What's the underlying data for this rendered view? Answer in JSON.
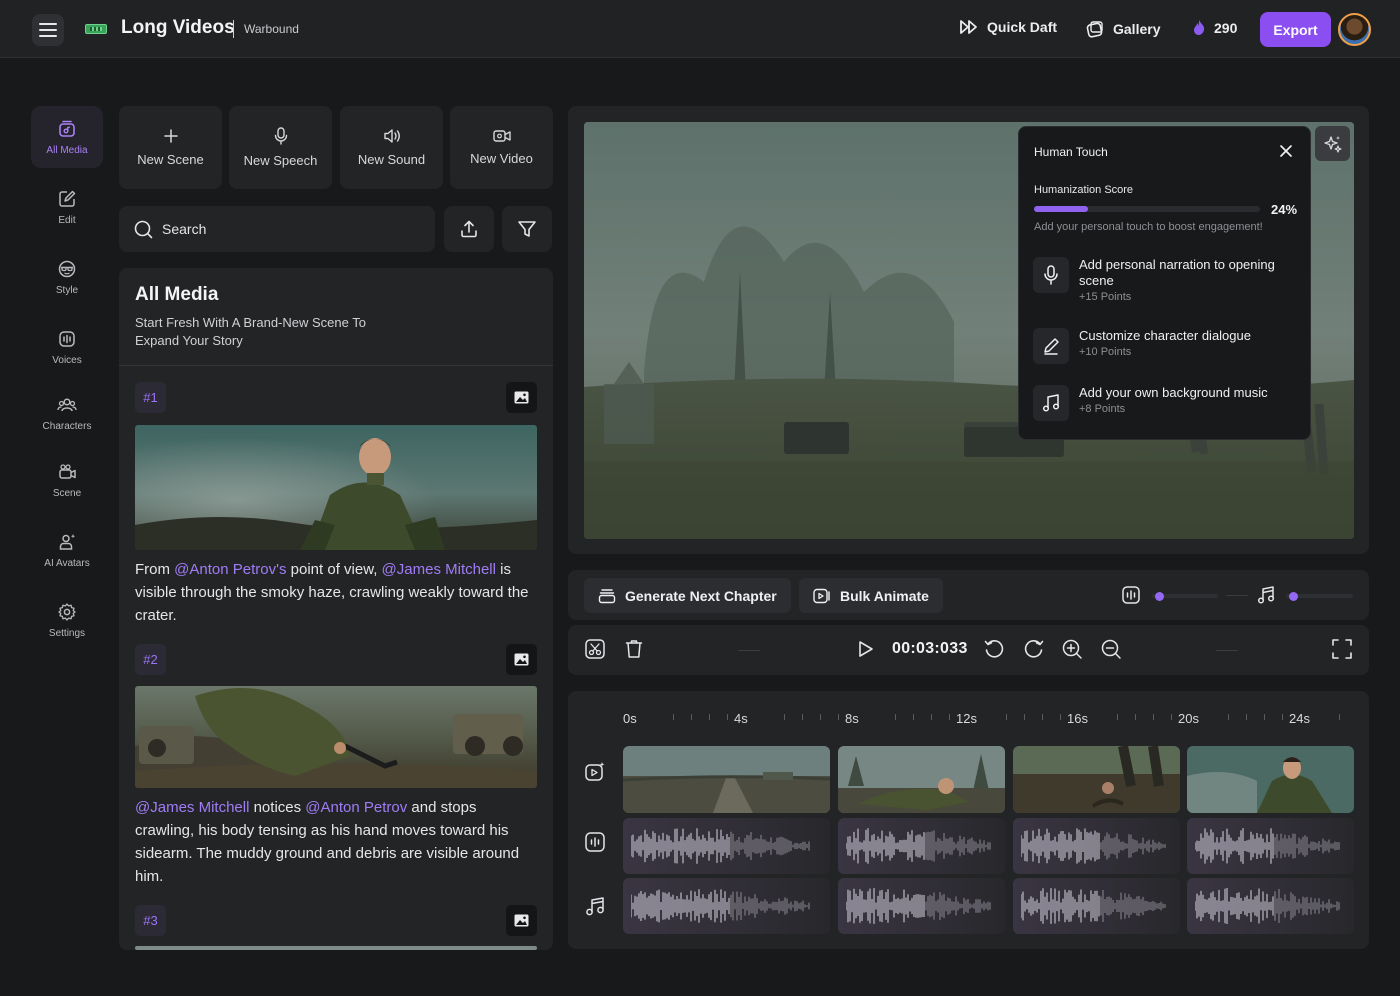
{
  "header": {
    "app_title": "Long Videos",
    "project_name": "Warbound",
    "quick_draft_label": "Quick Daft",
    "gallery_label": "Gallery",
    "credits": "290",
    "export_label": "Export",
    "colors": {
      "accent": "#8b4ef0",
      "background": "#18191b",
      "panel": "#232426"
    }
  },
  "sidebar": {
    "items": [
      {
        "label": "All Media",
        "icon": "media-icon",
        "active": true
      },
      {
        "label": "Edit",
        "icon": "edit-icon"
      },
      {
        "label": "Style",
        "icon": "style-icon"
      },
      {
        "label": "Voices",
        "icon": "voices-icon"
      },
      {
        "label": "Characters",
        "icon": "characters-icon"
      },
      {
        "label": "Scene",
        "icon": "scene-icon"
      },
      {
        "label": "AI Avatars",
        "icon": "avatar-icon"
      },
      {
        "label": "Settings",
        "icon": "gear-icon"
      }
    ]
  },
  "quick_actions": [
    {
      "label": "New Scene",
      "icon": "plus-icon"
    },
    {
      "label": "New Speech",
      "icon": "microphone-icon"
    },
    {
      "label": "New Sound",
      "icon": "speaker-icon"
    },
    {
      "label": "New Video",
      "icon": "video-camera-icon"
    }
  ],
  "search": {
    "placeholder": "Search"
  },
  "media": {
    "title": "All Media",
    "subtitle": "Start Fresh With A Brand-New Scene To Expand Your Story",
    "scenes": [
      {
        "tag": "#1",
        "mention_a": "@Anton Petrov's",
        "mention_b": "@James Mitchell",
        "text_1": "From ",
        "text_2": " point of view, ",
        "text_3": " is visible through the smoky haze, crawling weakly toward the crater."
      },
      {
        "tag": "#2",
        "mention_a": "@James Mitchell",
        "mention_b": "@Anton Petrov",
        "text_1": "",
        "text_2": " notices ",
        "text_3": " and stops crawling, his body tensing as his hand moves toward his sidearm. The muddy ground and debris are visible around him."
      },
      {
        "tag": "#3"
      }
    ]
  },
  "human_touch": {
    "title": "Human Touch",
    "score_label": "Humanization Score",
    "score_percent": "24%",
    "score_value": 24,
    "hint": "Add your personal touch to boost engagement!",
    "tasks": [
      {
        "label": "Add personal narration to opening scene",
        "points": "+15 Points",
        "icon": "microphone-icon"
      },
      {
        "label": "Customize character dialogue",
        "points": "+10 Points",
        "icon": "pen-icon"
      },
      {
        "label": "Add your own background music",
        "points": "+8 Points",
        "icon": "music-note-icon"
      }
    ]
  },
  "actions": {
    "generate_label": "Generate Next Chapter",
    "bulk_animate_label": "Bulk Animate",
    "voice_volume": 0.05,
    "music_volume": 0.05
  },
  "playback": {
    "timecode": "00:03:033"
  },
  "timeline": {
    "ticks": [
      "0s",
      "4s",
      "8s",
      "12s",
      "16s",
      "20s",
      "24s"
    ],
    "tracks": [
      "video-track-icon",
      "voice-track-icon",
      "music-track-icon"
    ],
    "clip_count": 4
  }
}
